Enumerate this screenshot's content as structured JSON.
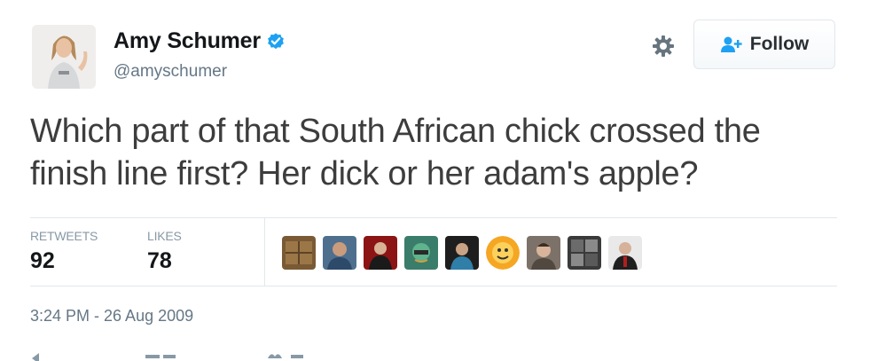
{
  "user": {
    "display_name": "Amy Schumer",
    "handle": "@amyschumer",
    "verified": true
  },
  "follow_button": {
    "label": "Follow",
    "icon": "add-user-icon"
  },
  "settings_icon": "gear-icon",
  "tweet": {
    "text": "Which part of that South African chick crossed the finish line first? Her dick or her adam's apple?"
  },
  "stats": {
    "retweets_label": "RETWEETS",
    "retweets_count": "92",
    "likes_label": "LIKES",
    "likes_count": "78"
  },
  "likers_count_shown": 9,
  "timestamp": "3:24 PM - 26 Aug 2009",
  "colors": {
    "verified_blue": "#1da1f2",
    "secondary_text": "#657786",
    "divider": "#e1e8ed"
  }
}
